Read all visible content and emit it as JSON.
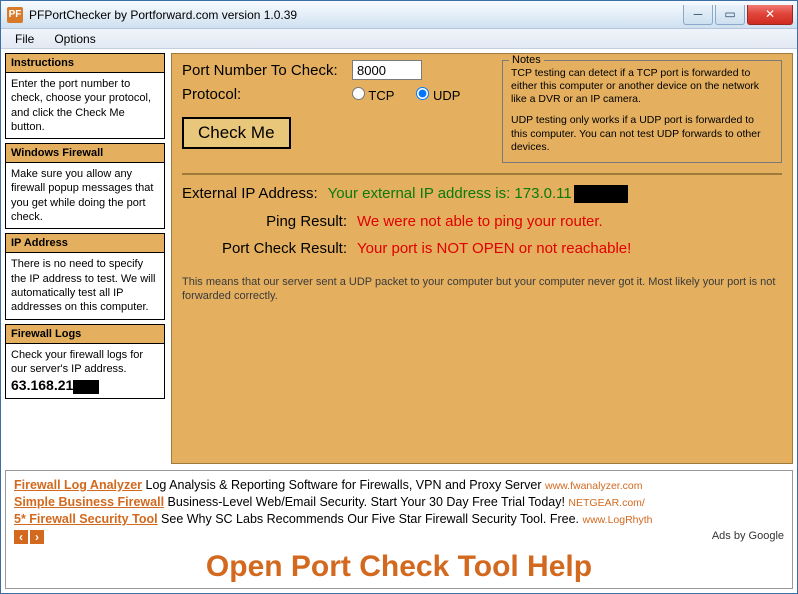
{
  "window": {
    "title": "PFPortChecker by Portforward.com version 1.0.39",
    "icon_text": "PF"
  },
  "menubar": {
    "file": "File",
    "options": "Options"
  },
  "sidebar": {
    "instructions": {
      "title": "Instructions",
      "body": "Enter the port number to check, choose your protocol, and click the Check Me button."
    },
    "firewall": {
      "title": "Windows Firewall",
      "body": "Make sure you allow any firewall popup messages that you get while doing the port check."
    },
    "ip": {
      "title": "IP Address",
      "body": "There is no need to specify the IP address to test. We will automatically test all IP addresses on this computer."
    },
    "logs": {
      "title": "Firewall Logs",
      "body": "Check your firewall logs for our server's IP address.",
      "ip": "63.168.21"
    }
  },
  "form": {
    "port_label": "Port Number To Check:",
    "port_value": "8000",
    "protocol_label": "Protocol:",
    "tcp_label": "TCP",
    "udp_label": "UDP",
    "check_button": "Check Me"
  },
  "notes": {
    "legend": "Notes",
    "p1": "TCP testing can detect if a TCP port is forwarded to either this computer or another device on the network like a DVR or an IP camera.",
    "p2": "UDP testing only works if a UDP port is forwarded to this computer. You can not test UDP forwards to other devices."
  },
  "results": {
    "ext_ip_label": "External IP Address:",
    "ext_ip_value": "Your external IP address is: 173.0.11",
    "ping_label": "Ping Result:",
    "ping_value": "We were not able to ping your router.",
    "port_label": "Port Check Result:",
    "port_value": "Your port is NOT OPEN or not reachable!",
    "explain": "This means that our server sent a UDP packet to your computer but your computer never got it. Most likely your port is not forwarded correctly."
  },
  "ads": {
    "row1": {
      "link": "Firewall Log Analyzer",
      "text": " Log Analysis & Reporting Software for Firewalls, VPN and Proxy Server ",
      "url": "www.fwanalyzer.com"
    },
    "row2": {
      "link": "Simple Business Firewall",
      "text": " Business-Level Web/Email Security. Start Your 30 Day Free Trial Today! ",
      "url": "NETGEAR.com/"
    },
    "row3": {
      "link": "5* Firewall Security Tool",
      "text": " See Why SC Labs Recommends Our Five Star Firewall Security Tool. Free. ",
      "url": "www.LogRhyth"
    },
    "adsby": "Ads by Google"
  },
  "big_title": "Open Port Check Tool Help"
}
